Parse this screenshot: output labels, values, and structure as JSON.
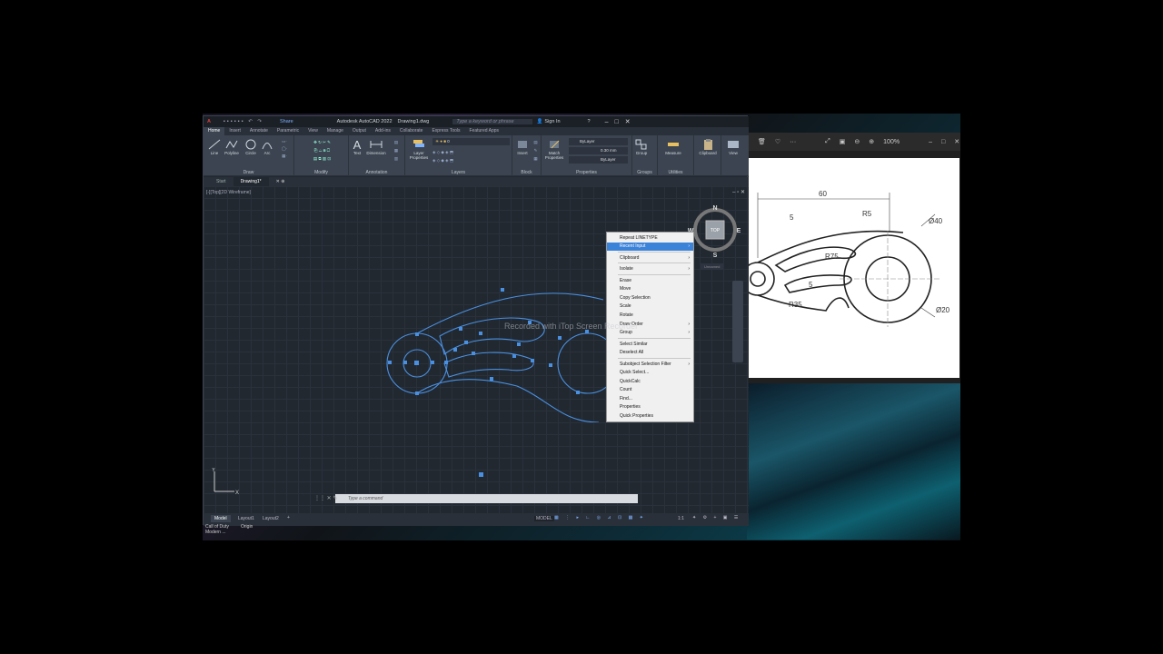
{
  "autocad": {
    "app_menu": "A",
    "share": "Share",
    "title": "Autodesk AutoCAD 2022",
    "file": "Drawing1.dwg",
    "search_placeholder": "Type a keyword or phrase",
    "sign_in": "Sign In",
    "ribbon_tabs": [
      "Home",
      "Insert",
      "Annotate",
      "Parametric",
      "View",
      "Manage",
      "Output",
      "Add-ins",
      "Collaborate",
      "Express Tools",
      "Featured Apps"
    ],
    "draw_tools": [
      "Line",
      "Polyline",
      "Circle",
      "Arc"
    ],
    "panels": {
      "draw": "Draw",
      "modify": "Modify",
      "annotation": "Annotation",
      "layers": "Layers",
      "block": "Block",
      "properties": "Properties",
      "groups": "Groups",
      "utilities": "Utilities"
    },
    "text_tool": "Text",
    "dimension_tool": "Dimension",
    "layer_properties": "Layer Properties",
    "insert_tool": "Insert",
    "match_properties": "Match Properties",
    "group_tool": "Group",
    "measure_tool": "Measure",
    "clipboard_tool": "Clipboard",
    "view_tool": "View",
    "bylayer": "ByLayer",
    "lineweight": "0.30 mm",
    "layer_value": "0",
    "doc_tabs": [
      "Start",
      "Drawing1*"
    ],
    "viewport_label": "[-][Top][2D Wireframe]",
    "viewcube": {
      "n": "N",
      "s": "S",
      "e": "E",
      "w": "W",
      "top": "TOP",
      "wcs": "Unnamed"
    },
    "command_placeholder": "Type a command",
    "layout_tabs": [
      "Model",
      "Layout1",
      "Layout2"
    ],
    "status_model": "MODEL",
    "scale": "1:1",
    "ucs_y": "Y",
    "ucs_x": "X"
  },
  "context_menu": {
    "items": [
      {
        "label": "Repeat LINETYPE",
        "arrow": false,
        "highlight": false
      },
      {
        "label": "Recent Input",
        "arrow": true,
        "highlight": true
      },
      {
        "label": "Clipboard",
        "arrow": true,
        "highlight": false
      },
      {
        "label": "Isolate",
        "arrow": true,
        "highlight": false
      },
      {
        "label": "Erase",
        "arrow": false,
        "highlight": false
      },
      {
        "label": "Move",
        "arrow": false,
        "highlight": false
      },
      {
        "label": "Copy Selection",
        "arrow": false,
        "highlight": false
      },
      {
        "label": "Scale",
        "arrow": false,
        "highlight": false
      },
      {
        "label": "Rotate",
        "arrow": false,
        "highlight": false
      },
      {
        "label": "Draw Order",
        "arrow": true,
        "highlight": false
      },
      {
        "label": "Group",
        "arrow": true,
        "highlight": false
      },
      {
        "label": "Select Similar",
        "arrow": false,
        "highlight": false
      },
      {
        "label": "Deselect All",
        "arrow": false,
        "highlight": false
      },
      {
        "label": "Subobject Selection Filter",
        "arrow": true,
        "highlight": false
      },
      {
        "label": "Quick Select...",
        "arrow": false,
        "highlight": false
      },
      {
        "label": "QuickCalc",
        "arrow": false,
        "highlight": false
      },
      {
        "label": "Count",
        "arrow": false,
        "highlight": false
      },
      {
        "label": "Find...",
        "arrow": false,
        "highlight": false
      },
      {
        "label": "Properties",
        "arrow": false,
        "highlight": false
      },
      {
        "label": "Quick Properties",
        "arrow": false,
        "highlight": false
      }
    ]
  },
  "watermark": "Recorded with iTop Screen Recorder",
  "viewer": {
    "zoom": "100%",
    "dims": {
      "d60": "60",
      "d5a": "5",
      "r5": "R5",
      "d40": "Ø40",
      "r75": "R75",
      "d5b": "5",
      "r35": "R35",
      "d20": "Ø20"
    }
  },
  "taskbar": {
    "item1_line1": "Call of Duty",
    "item1_line2": "Modern ...",
    "item2": "Origin"
  },
  "colors": {
    "accent": "#3b82d9",
    "selection": "#4a90e2",
    "canvas": "#212830"
  }
}
